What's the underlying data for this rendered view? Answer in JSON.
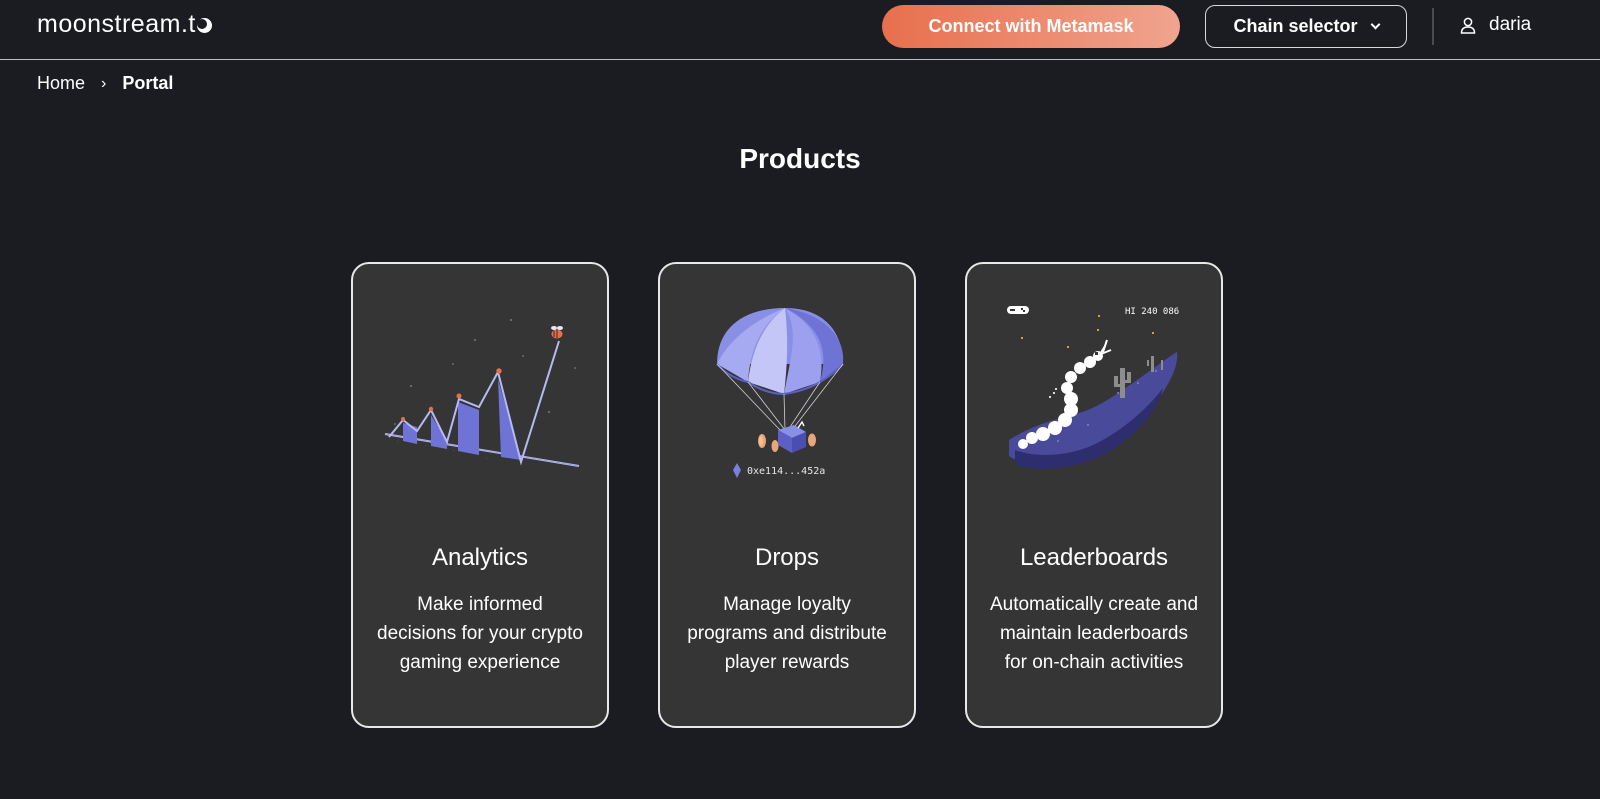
{
  "header": {
    "logo_text": "moonstream.t",
    "connect_label": "Connect with Metamask",
    "chain_selector_label": "Chain selector",
    "user_name": "daria"
  },
  "breadcrumb": {
    "home": "Home",
    "current": "Portal"
  },
  "page": {
    "title": "Products"
  },
  "products": [
    {
      "title": "Analytics",
      "description": "Make informed decisions for your crypto gaming experience",
      "icon": "growth-chart-illustration"
    },
    {
      "title": "Drops",
      "description": "Manage loyalty programs and distribute player rewards",
      "icon": "parachute-drop-illustration",
      "address_label": "0xe114...452a"
    },
    {
      "title": "Leaderboards",
      "description": "Automatically create and maintain leaderboards for on-chain activities",
      "icon": "pixel-snake-illustration",
      "score_label": "HI 240 086"
    }
  ],
  "colors": {
    "background": "#1b1c21",
    "card_background": "#353535",
    "accent_gradient_start": "#e86f4d",
    "accent_gradient_end": "#f0a48f",
    "illustration_purple": "#6f73d6"
  }
}
